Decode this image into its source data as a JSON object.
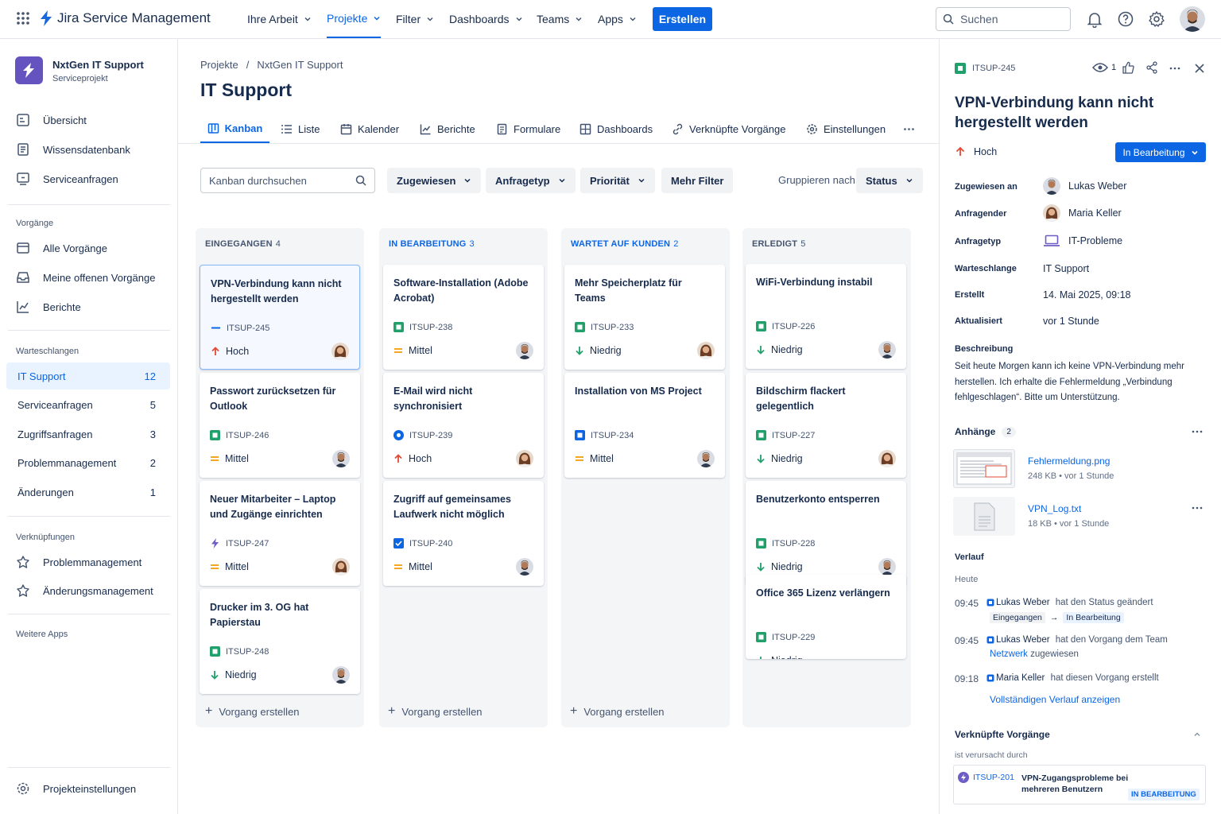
{
  "app": {
    "name": "Jira Service Management"
  },
  "topnav": {
    "items": [
      {
        "label": "Ihre Arbeit"
      },
      {
        "label": "Projekte"
      },
      {
        "label": "Filter"
      },
      {
        "label": "Dashboards"
      },
      {
        "label": "Teams"
      },
      {
        "label": "Apps"
      }
    ],
    "create_label": "Erstellen",
    "search_placeholder": "Suchen"
  },
  "sidebar": {
    "project_name": "NxtGen IT Support",
    "project_type": "Serviceprojekt",
    "main_items": [
      {
        "label": "Übersicht",
        "icon": "overview-icon"
      },
      {
        "label": "Wissensdatenbank",
        "icon": "book-icon"
      },
      {
        "label": "Serviceanfragen",
        "icon": "request-icon"
      }
    ],
    "issues_heading": "Vorgänge",
    "issue_items": [
      {
        "label": "Alle Vorgänge",
        "icon": "list-icon"
      },
      {
        "label": "Meine offenen Vorgänge",
        "icon": "inbox-icon"
      },
      {
        "label": "Berichte",
        "icon": "chart-icon"
      }
    ],
    "queues_heading": "Warteschlangen",
    "queues": [
      {
        "label": "IT Support",
        "count": "12"
      },
      {
        "label": "Serviceanfragen",
        "count": "5"
      },
      {
        "label": "Zugriffsanfragen",
        "count": "3"
      },
      {
        "label": "Problemmanagement",
        "count": "2"
      },
      {
        "label": "Änderungen",
        "count": "1"
      }
    ],
    "links_heading": "Verknüpfungen",
    "links": [
      {
        "label": "Problemmanagement"
      },
      {
        "label": "Änderungsmanagement"
      }
    ],
    "more_apps_heading": "Weitere Apps",
    "settings_label": "Projekteinstellungen"
  },
  "main": {
    "breadcrumb": [
      "Projekte",
      "NxtGen IT Support"
    ],
    "title": "IT Support",
    "tabs": [
      {
        "label": "Kanban"
      },
      {
        "label": "Liste"
      },
      {
        "label": "Kalender"
      },
      {
        "label": "Berichte"
      },
      {
        "label": "Formulare"
      },
      {
        "label": "Dashboards"
      },
      {
        "label": "Verknüpfte Vorgänge"
      },
      {
        "label": "Einstellungen"
      }
    ],
    "search_placeholder": "Kanban durchsuchen",
    "filters": [
      "Zugewiesen",
      "Anfragetyp",
      "Priorität",
      "Mehr Filter"
    ],
    "group_by_label": "Gruppieren nach",
    "group_by_value": "Status",
    "add_issue_label": "Vorgang erstellen"
  },
  "board": {
    "columns": [
      {
        "title": "EINGEGANGEN",
        "count": "4",
        "cards": [
          {
            "title": "VPN-Verbindung kann nicht hergestellt werden",
            "key": "ITSUP-245",
            "priority": "Hoch",
            "type": "task-line"
          },
          {
            "title": "Passwort zurücksetzen für Outlook",
            "key": "ITSUP-246",
            "priority": "Mittel",
            "type": "story"
          },
          {
            "title": "Neuer Mitarbeiter – Laptop und Zugänge einrichten",
            "key": "ITSUP-247",
            "priority": "Mittel",
            "type": "bolt"
          },
          {
            "title": "Drucker im 3. OG hat Papierstau",
            "key": "ITSUP-248",
            "priority": "Niedrig",
            "type": "story"
          }
        ]
      },
      {
        "title": "IN BEARBEITUNG",
        "count": "3",
        "cards": [
          {
            "title": "Software-Installation (Adobe Acrobat)",
            "key": "ITSUP-238",
            "priority": "Mittel",
            "type": "story"
          },
          {
            "title": "E-Mail wird nicht synchronisiert",
            "key": "ITSUP-239",
            "priority": "Hoch",
            "type": "circle"
          },
          {
            "title": "Zugriff auf gemeinsames Laufwerk nicht möglich",
            "key": "ITSUP-240",
            "priority": "Mittel",
            "type": "check"
          }
        ]
      },
      {
        "title": "WARTET AUF KUNDEN",
        "count": "2",
        "cards": [
          {
            "title": "Mehr Speicherplatz für Teams",
            "key": "ITSUP-233",
            "priority": "Niedrig",
            "type": "story"
          },
          {
            "title": "Installation von MS Project",
            "key": "ITSUP-234",
            "priority": "Mittel",
            "type": "square"
          }
        ]
      },
      {
        "title": "ERLEDIGT",
        "count": "5",
        "cards": [
          {
            "title": "WiFi-Verbindung instabil",
            "key": "ITSUP-226",
            "priority": "Niedrig",
            "type": "story"
          },
          {
            "title": "Bildschirm flackert gelegentlich",
            "key": "ITSUP-227",
            "priority": "Niedrig",
            "type": "story"
          },
          {
            "title": "Benutzerkonto entsperren",
            "key": "ITSUP-228",
            "priority": "Niedrig",
            "type": "story"
          },
          {
            "title": "Office 365 Lizenz verlängern",
            "key": "ITSUP-229",
            "priority": "Niedrig",
            "type": "story"
          }
        ]
      }
    ]
  },
  "detail": {
    "key": "ITSUP-245",
    "watchers": "1",
    "title": "VPN-Verbindung kann nicht hergestellt werden",
    "priority": "Hoch",
    "status": "In Bearbeitung",
    "fields": {
      "assignee_label": "Zugewiesen an",
      "assignee": "Lukas Weber",
      "reporter_label": "Anfragender",
      "reporter": "Maria Keller",
      "type_label": "Anfragetyp",
      "type": "IT-Probleme",
      "queue_label": "Warteschlange",
      "queue": "IT Support",
      "created_label": "Erstellt",
      "created": "14. Mai 2025, 09:18",
      "updated_label": "Aktualisiert",
      "updated": "vor 1 Stunde"
    },
    "description_label": "Beschreibung",
    "description": "Seit heute Morgen kann ich keine VPN-Verbindung mehr herstellen. Ich erhalte die Fehlermeldung „Verbindung fehlgeschlagen“. Bitte um Unterstützung.",
    "attachments_label": "Anhänge",
    "attachments_count": "2",
    "attachments": [
      {
        "name": "Fehlermeldung.png",
        "meta": "248 KB • vor 1 Stunde"
      },
      {
        "name": "VPN_Log.txt",
        "meta": "18 KB • vor 1 Stunde"
      }
    ],
    "history_label": "Verlauf",
    "history_day": "Heute",
    "history": [
      {
        "time": "09:45",
        "user": "Lukas Weber",
        "text": "hat den Status geändert",
        "from": "Eingegangen",
        "to": "In Bearbeitung"
      },
      {
        "time": "09:45",
        "user": "Lukas Weber",
        "text": "hat den Vorgang dem Team",
        "team": "Netzwerk",
        "suffix": "zugewiesen"
      },
      {
        "time": "09:18",
        "user": "Maria Keller",
        "text": "hat diesen Vorgang erstellt"
      }
    ],
    "history_link": "Vollständigen Verlauf anzeigen",
    "linked_label": "Verknüpfte Vorgänge",
    "linked_relation": "ist verursacht durch",
    "linked_item": {
      "key": "ITSUP-201",
      "title": "VPN-Zugangsprobleme bei mehreren Benutzern",
      "status": "IN BEARBEITUNG"
    }
  },
  "colors": {
    "accent": "#0c66e4",
    "high": "#e34935",
    "medium": "#f5a623",
    "low": "#22a06b",
    "story": "#22a06b"
  }
}
